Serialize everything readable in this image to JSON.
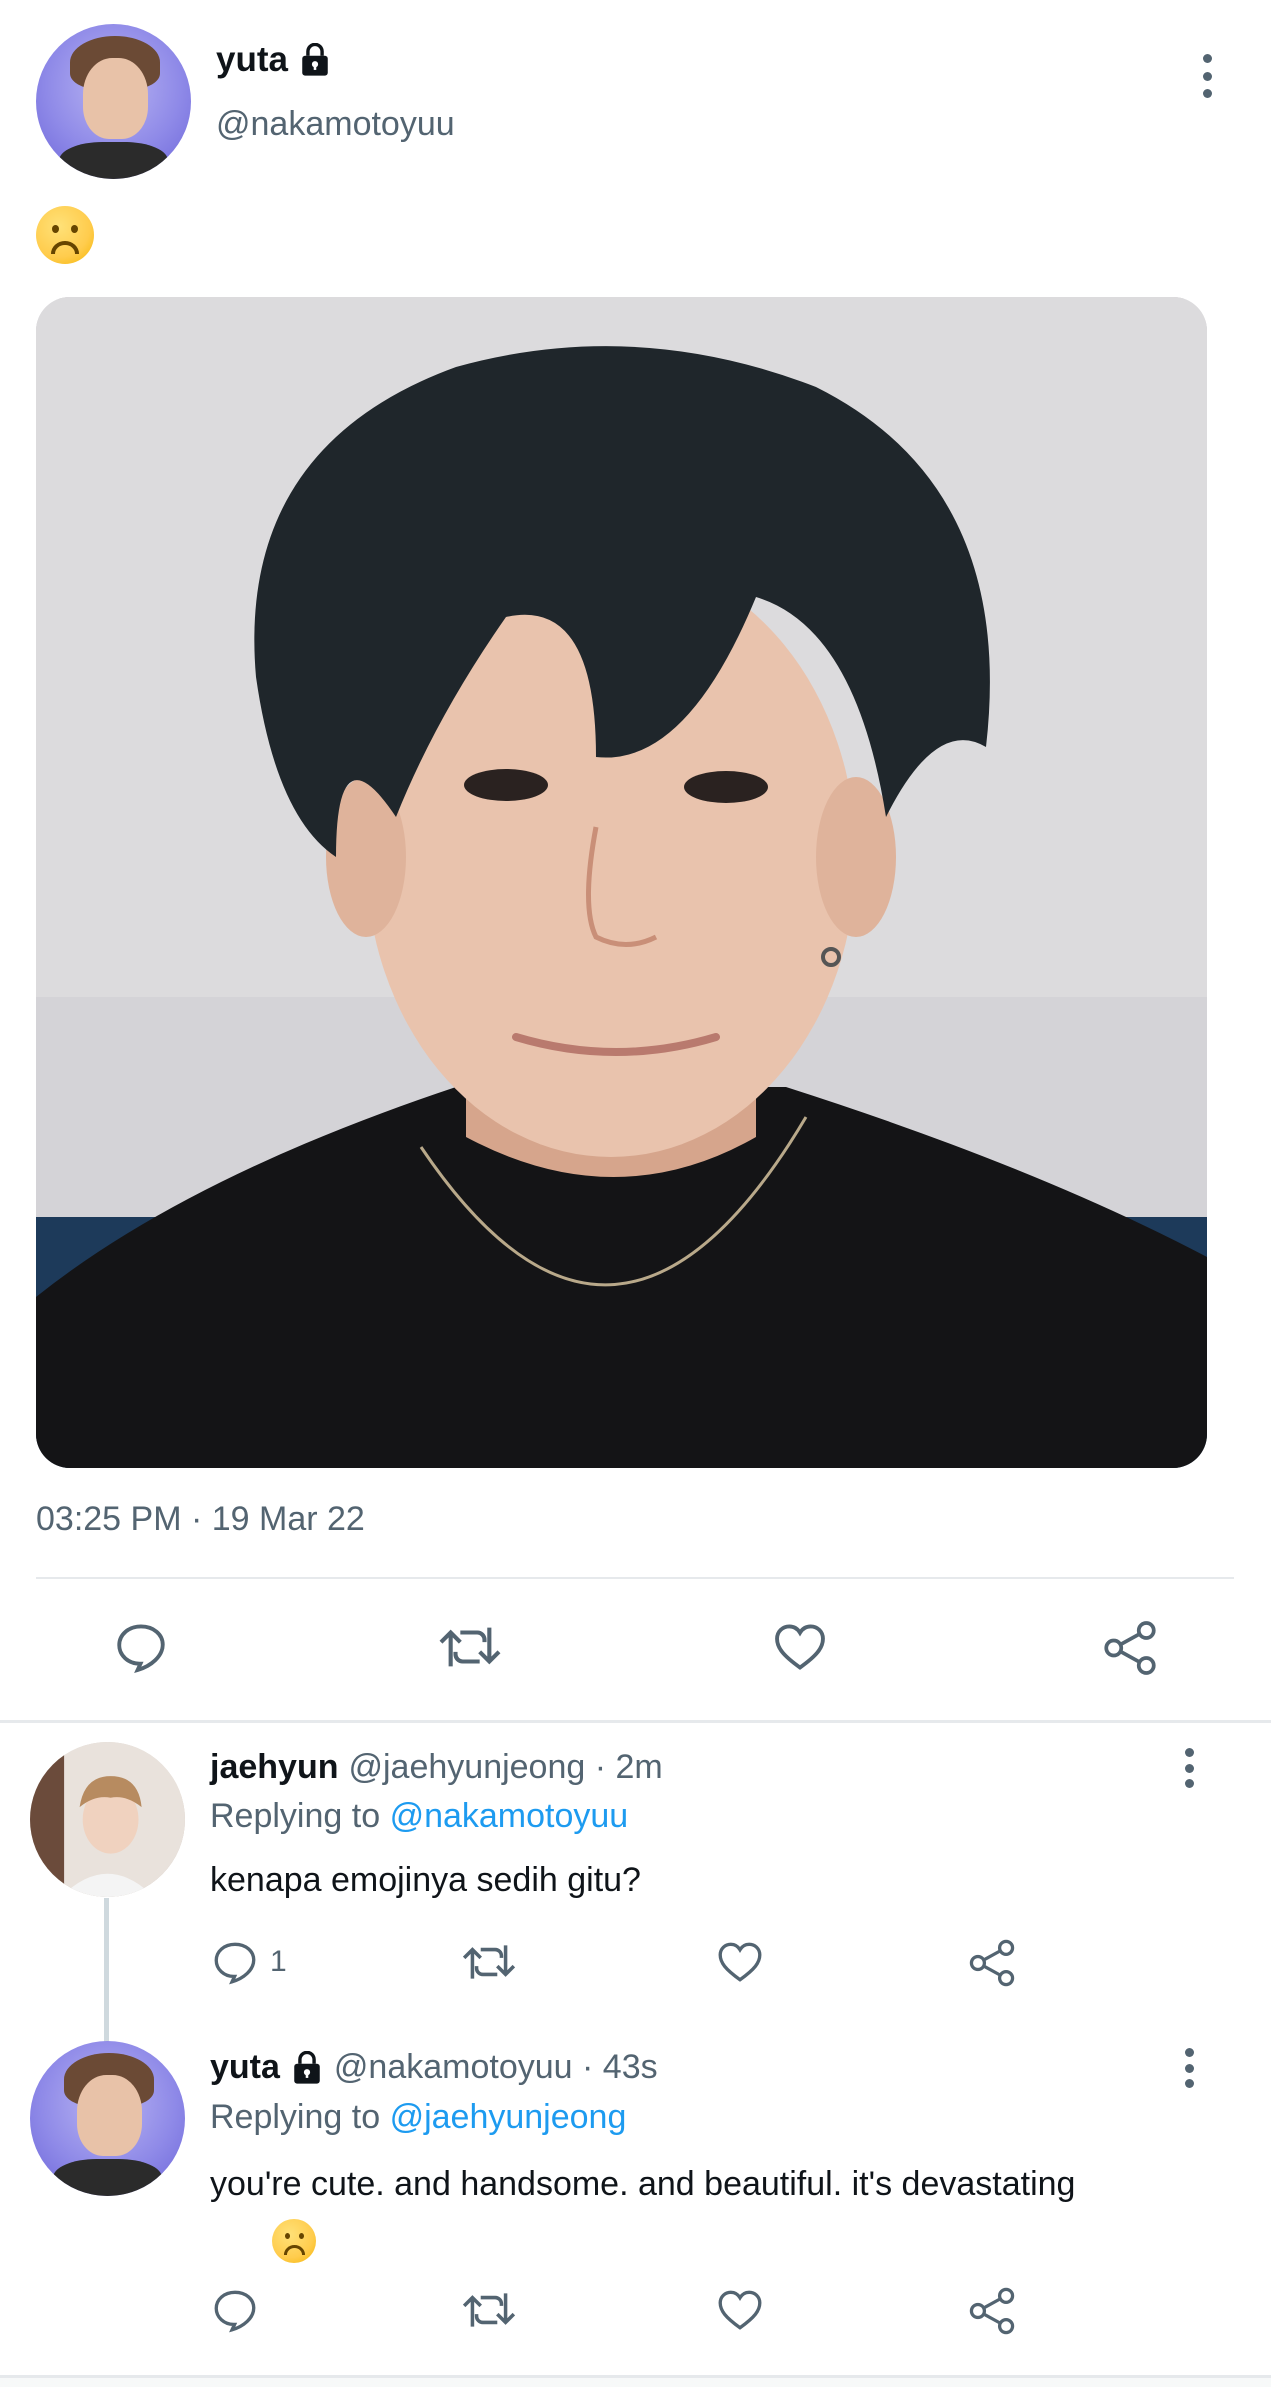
{
  "main_tweet": {
    "display_name": "yuta",
    "handle": "@nakamotoyuu",
    "text_emoji": "☹️",
    "timestamp": "03:25 PM · 19 Mar 22"
  },
  "replies": [
    {
      "display_name": "jaehyun",
      "handle_time": "@jaehyunjeong · 2m",
      "replying_prefix": "Replying to",
      "replying_to": "@nakamotoyuu",
      "text": "kenapa emojinya sedih gitu?",
      "reply_count": "1"
    },
    {
      "display_name": "yuta",
      "handle_time": "@nakamotoyuu · 43s",
      "replying_prefix": "Replying to",
      "replying_to": "@jaehyunjeong",
      "text": "you're cute. and handsome. and beautiful. it's devastating",
      "text_emoji": "☹️"
    }
  ],
  "icons": [
    "lock-icon",
    "more-options-icon",
    "reply-icon",
    "retweet-icon",
    "like-icon",
    "share-icon",
    "frowning-face-emoji"
  ],
  "colors": {
    "text": "#0f1419",
    "secondary": "#536471",
    "link": "#1d9bf0",
    "divider": "#e6e9ec",
    "avatar_bg": "#8f8ae8"
  }
}
